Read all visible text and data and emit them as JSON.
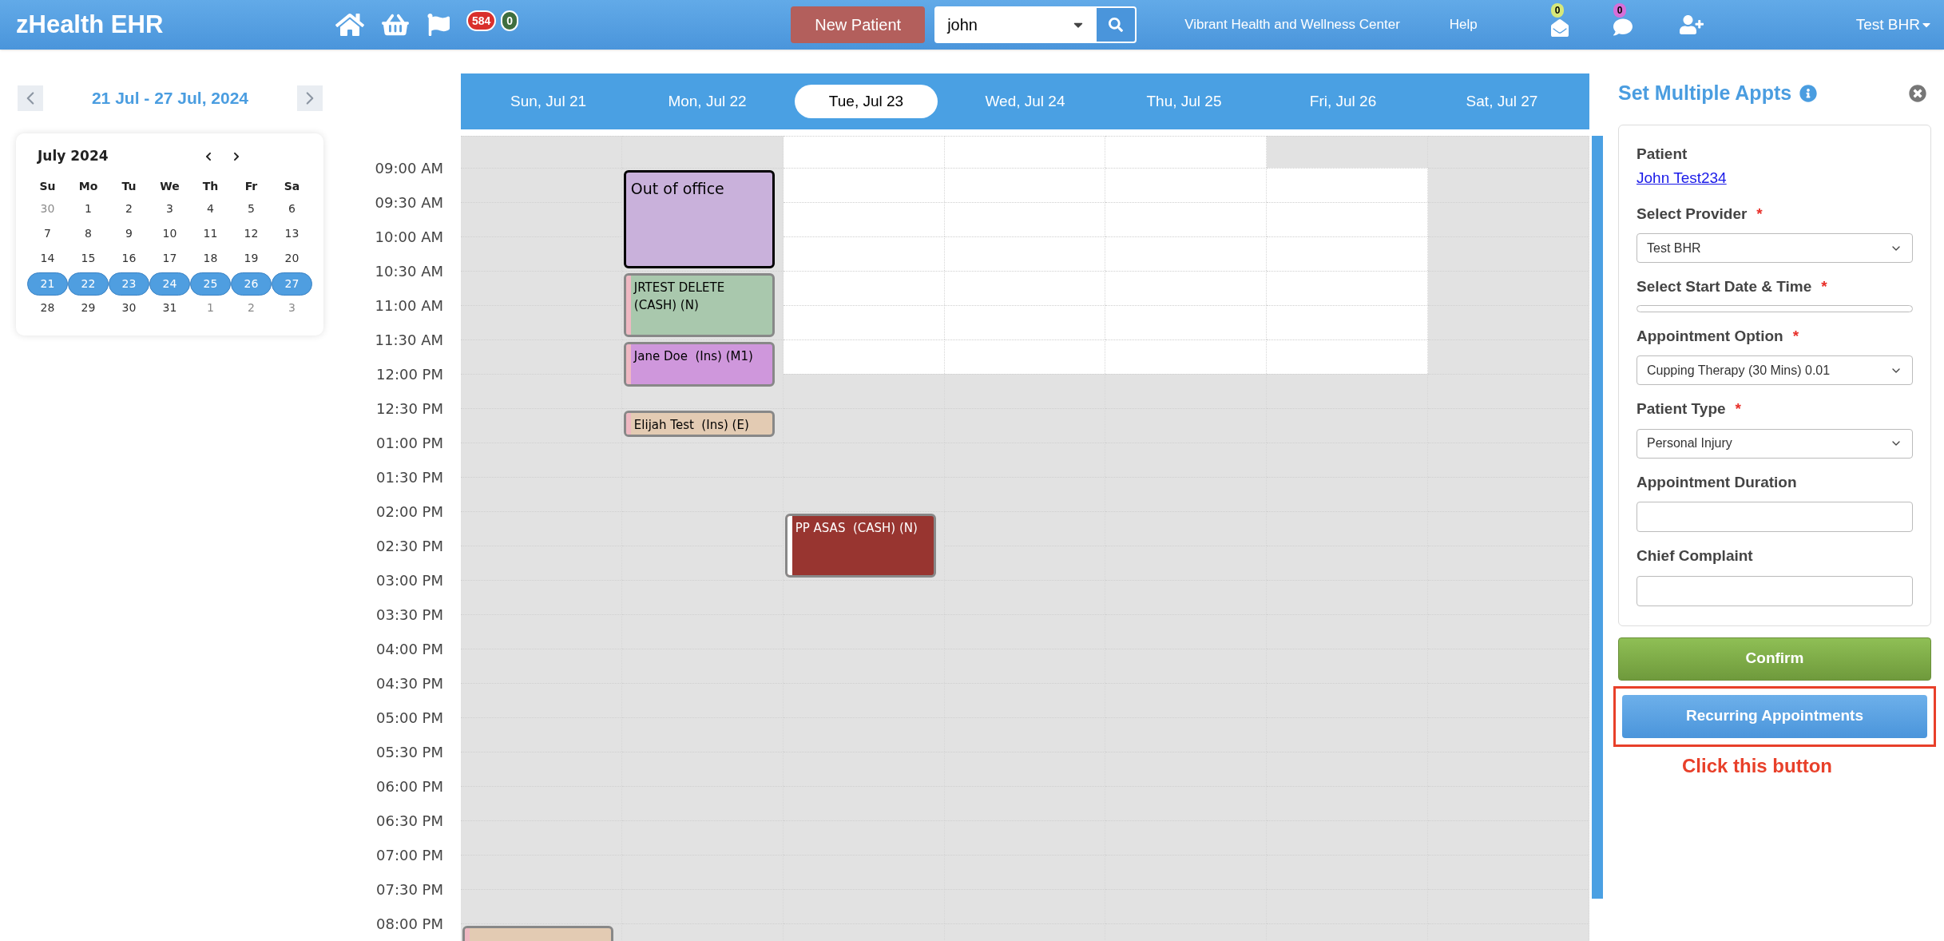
{
  "topbar": {
    "brand": "zHealth EHR",
    "badges": [
      {
        "count": "584",
        "color": "#d9302c"
      },
      {
        "count": "0",
        "color": "#3f6e3f"
      }
    ],
    "new_patient": "New Patient",
    "search": {
      "value": "john"
    },
    "clinic": "Vibrant Health and Wellness Center",
    "help": "Help",
    "mail_badge": {
      "count": "0",
      "color": "#d6e87a"
    },
    "chat_badge": {
      "count": "0",
      "color": "#d66fd8"
    },
    "user": "Test BHR"
  },
  "week_nav": {
    "range": "21 Jul - 27 Jul, 2024"
  },
  "mini_calendar": {
    "title": "July 2024",
    "weekdays": [
      "Su",
      "Mo",
      "Tu",
      "We",
      "Th",
      "Fr",
      "Sa"
    ],
    "weeks": [
      [
        {
          "day": "30",
          "outside": true,
          "selected": false
        },
        {
          "day": "1",
          "outside": false,
          "selected": false
        },
        {
          "day": "2",
          "outside": false,
          "selected": false
        },
        {
          "day": "3",
          "outside": false,
          "selected": false
        },
        {
          "day": "4",
          "outside": false,
          "selected": false
        },
        {
          "day": "5",
          "outside": false,
          "selected": false
        },
        {
          "day": "6",
          "outside": false,
          "selected": false
        }
      ],
      [
        {
          "day": "7",
          "outside": false,
          "selected": false
        },
        {
          "day": "8",
          "outside": false,
          "selected": false
        },
        {
          "day": "9",
          "outside": false,
          "selected": false
        },
        {
          "day": "10",
          "outside": false,
          "selected": false
        },
        {
          "day": "11",
          "outside": false,
          "selected": false
        },
        {
          "day": "12",
          "outside": false,
          "selected": false
        },
        {
          "day": "13",
          "outside": false,
          "selected": false
        }
      ],
      [
        {
          "day": "14",
          "outside": false,
          "selected": false
        },
        {
          "day": "15",
          "outside": false,
          "selected": false
        },
        {
          "day": "16",
          "outside": false,
          "selected": false
        },
        {
          "day": "17",
          "outside": false,
          "selected": false
        },
        {
          "day": "18",
          "outside": false,
          "selected": false
        },
        {
          "day": "19",
          "outside": false,
          "selected": false
        },
        {
          "day": "20",
          "outside": false,
          "selected": false
        }
      ],
      [
        {
          "day": "21",
          "outside": false,
          "selected": true
        },
        {
          "day": "22",
          "outside": false,
          "selected": true
        },
        {
          "day": "23",
          "outside": false,
          "selected": true
        },
        {
          "day": "24",
          "outside": false,
          "selected": true
        },
        {
          "day": "25",
          "outside": false,
          "selected": true
        },
        {
          "day": "26",
          "outside": false,
          "selected": true
        },
        {
          "day": "27",
          "outside": false,
          "selected": true
        }
      ],
      [
        {
          "day": "28",
          "outside": false,
          "selected": false
        },
        {
          "day": "29",
          "outside": false,
          "selected": false
        },
        {
          "day": "30",
          "outside": false,
          "selected": false
        },
        {
          "day": "31",
          "outside": false,
          "selected": false
        },
        {
          "day": "1",
          "outside": true,
          "selected": false
        },
        {
          "day": "2",
          "outside": true,
          "selected": false
        },
        {
          "day": "3",
          "outside": true,
          "selected": false
        }
      ]
    ]
  },
  "week_header": [
    {
      "label": "Sun, Jul 21",
      "selected": false
    },
    {
      "label": "Mon, Jul 22",
      "selected": false
    },
    {
      "label": "Tue, Jul 23",
      "selected": true
    },
    {
      "label": "Wed, Jul 24",
      "selected": false
    },
    {
      "label": "Thu, Jul 25",
      "selected": false
    },
    {
      "label": "Fri, Jul 26",
      "selected": false
    },
    {
      "label": "Sat, Jul 27",
      "selected": false
    }
  ],
  "time_slots": [
    {
      "cells": [
        {
          "open": false
        },
        {
          "open": false
        },
        {
          "open": true
        },
        {
          "open": true
        },
        {
          "open": true
        },
        {
          "open": false
        },
        {
          "open": false
        }
      ]
    },
    {
      "label": "09:00 AM",
      "cells": [
        {
          "open": false
        },
        {
          "open": false,
          "event": {
            "kind": "out-of-office",
            "text": "Out of office",
            "short": false,
            "color": "#c9b1db"
          }
        },
        {
          "open": true
        },
        {
          "open": true
        },
        {
          "open": true
        },
        {
          "open": true
        },
        {
          "open": false
        }
      ]
    },
    {
      "label": "09:30 AM",
      "cells": [
        {
          "open": false
        },
        {
          "covered": true
        },
        {
          "open": true
        },
        {
          "open": true
        },
        {
          "open": true
        },
        {
          "open": true
        },
        {
          "open": false
        }
      ]
    },
    {
      "label": "10:00 AM",
      "cells": [
        {
          "open": false
        },
        {
          "covered": true
        },
        {
          "open": true
        },
        {
          "open": true
        },
        {
          "open": true
        },
        {
          "open": true
        },
        {
          "open": false
        }
      ]
    },
    {
      "label": "10:30 AM",
      "cells": [
        {
          "open": false
        },
        {
          "open": false,
          "event": {
            "kind": "appointment",
            "text": "JRTEST DELETE  (CASH) (N)",
            "short": false,
            "color": "#a9c8ad"
          }
        },
        {
          "open": true
        },
        {
          "open": true
        },
        {
          "open": true
        },
        {
          "open": true
        },
        {
          "open": false
        }
      ]
    },
    {
      "label": "11:00 AM",
      "cells": [
        {
          "open": false
        },
        {
          "covered": true
        },
        {
          "open": true
        },
        {
          "open": true
        },
        {
          "open": true
        },
        {
          "open": true
        },
        {
          "open": false
        }
      ]
    },
    {
      "label": "11:30 AM",
      "cells": [
        {
          "open": false
        },
        {
          "open": false,
          "event": {
            "kind": "appointment",
            "text": "Jane Doe  (Ins) (M1)",
            "short": true,
            "color": "#cf97dc"
          }
        },
        {
          "open": true
        },
        {
          "open": true
        },
        {
          "open": true
        },
        {
          "open": true
        },
        {
          "open": false
        }
      ]
    },
    {
      "label": "12:00 PM",
      "cells": [
        {
          "open": false
        },
        {
          "covered": true
        },
        {
          "open": false
        },
        {
          "open": false
        },
        {
          "open": false
        },
        {
          "open": false
        },
        {
          "open": false
        }
      ]
    },
    {
      "label": "12:30 PM",
      "cells": [
        {
          "open": false
        },
        {
          "open": false,
          "event": {
            "kind": "appointment",
            "text": "Elijah Test  (Ins) (E)",
            "short": false,
            "color": "#e3cbb3"
          }
        },
        {
          "open": false
        },
        {
          "open": false
        },
        {
          "open": false
        },
        {
          "open": false
        },
        {
          "open": false
        }
      ]
    },
    {
      "label": "01:00 PM",
      "cells": [
        {
          "open": false
        },
        {
          "open": false
        },
        {
          "open": false
        },
        {
          "open": false
        },
        {
          "open": false
        },
        {
          "open": false
        },
        {
          "open": false
        }
      ]
    },
    {
      "label": "01:30 PM",
      "cells": [
        {
          "open": false
        },
        {
          "open": false
        },
        {
          "open": false
        },
        {
          "open": false
        },
        {
          "open": false
        },
        {
          "open": false
        },
        {
          "open": false
        }
      ]
    },
    {
      "label": "02:00 PM",
      "cells": [
        {
          "open": false
        },
        {
          "open": false
        },
        {
          "open": false,
          "event": {
            "kind": "appointment",
            "text": "PP ASAS  (CASH) (N)",
            "short": false,
            "color": "#983530"
          }
        },
        {
          "open": false
        },
        {
          "open": false
        },
        {
          "open": false
        },
        {
          "open": false
        }
      ]
    },
    {
      "label": "02:30 PM",
      "cells": [
        {
          "open": false
        },
        {
          "open": false
        },
        {
          "covered": true
        },
        {
          "open": false
        },
        {
          "open": false
        },
        {
          "open": false
        },
        {
          "open": false
        }
      ]
    },
    {
      "label": "03:00 PM",
      "cells": [
        {
          "open": false
        },
        {
          "open": false
        },
        {
          "open": false
        },
        {
          "open": false
        },
        {
          "open": false
        },
        {
          "open": false
        },
        {
          "open": false
        }
      ]
    },
    {
      "label": "03:30 PM",
      "cells": [
        {
          "open": false
        },
        {
          "open": false
        },
        {
          "open": false
        },
        {
          "open": false
        },
        {
          "open": false
        },
        {
          "open": false
        },
        {
          "open": false
        }
      ]
    },
    {
      "label": "04:00 PM",
      "cells": [
        {
          "open": false
        },
        {
          "open": false
        },
        {
          "open": false
        },
        {
          "open": false
        },
        {
          "open": false
        },
        {
          "open": false
        },
        {
          "open": false
        }
      ]
    },
    {
      "label": "04:30 PM",
      "cells": [
        {
          "open": false
        },
        {
          "open": false
        },
        {
          "open": false
        },
        {
          "open": false
        },
        {
          "open": false
        },
        {
          "open": false
        },
        {
          "open": false
        }
      ]
    },
    {
      "label": "05:00 PM",
      "cells": [
        {
          "open": false
        },
        {
          "open": false
        },
        {
          "open": false
        },
        {
          "open": false
        },
        {
          "open": false
        },
        {
          "open": false
        },
        {
          "open": false
        }
      ]
    },
    {
      "label": "05:30 PM",
      "cells": [
        {
          "open": false
        },
        {
          "open": false
        },
        {
          "open": false
        },
        {
          "open": false
        },
        {
          "open": false
        },
        {
          "open": false
        },
        {
          "open": false
        }
      ]
    },
    {
      "label": "06:00 PM",
      "cells": [
        {
          "open": false
        },
        {
          "open": false
        },
        {
          "open": false
        },
        {
          "open": false
        },
        {
          "open": false
        },
        {
          "open": false
        },
        {
          "open": false
        }
      ]
    },
    {
      "label": "06:30 PM",
      "cells": [
        {
          "open": false
        },
        {
          "open": false
        },
        {
          "open": false
        },
        {
          "open": false
        },
        {
          "open": false
        },
        {
          "open": false
        },
        {
          "open": false
        }
      ]
    },
    {
      "label": "07:00 PM",
      "cells": [
        {
          "open": false
        },
        {
          "open": false
        },
        {
          "open": false
        },
        {
          "open": false
        },
        {
          "open": false
        },
        {
          "open": false
        },
        {
          "open": false
        }
      ]
    },
    {
      "label": "07:30 PM",
      "cells": [
        {
          "open": false
        },
        {
          "open": false
        },
        {
          "open": false
        },
        {
          "open": false
        },
        {
          "open": false
        },
        {
          "open": false
        },
        {
          "open": false
        }
      ]
    },
    {
      "label": "08:00 PM",
      "cells": [
        {
          "open": false,
          "event": {
            "kind": "appointment",
            "short": false,
            "color": "#e3cbb3"
          }
        },
        {
          "open": false
        },
        {
          "open": false
        },
        {
          "open": false
        },
        {
          "open": false
        },
        {
          "open": false
        },
        {
          "open": false
        }
      ]
    }
  ],
  "panel": {
    "title": "Set Multiple Appts",
    "fields": [
      {
        "label": "Patient",
        "kind": "link",
        "value": "John Test234"
      },
      {
        "label": "Select Provider",
        "kind": "select",
        "value": "Test BHR",
        "required_mark": "*"
      },
      {
        "label": "Select Start Date & Time",
        "kind": "slim",
        "required_mark": "*"
      },
      {
        "label": "Appointment Option",
        "kind": "select",
        "value": "Cupping Therapy (30 Mins) 0.01",
        "required_mark": "*"
      },
      {
        "label": "Patient Type",
        "kind": "select",
        "value": "Personal Injury",
        "required_mark": "*"
      },
      {
        "label": "Appointment Duration",
        "kind": "input"
      },
      {
        "label": "Chief Complaint",
        "kind": "input"
      }
    ],
    "confirm": "Confirm",
    "recurring": {
      "label": "Recurring Appointments",
      "highlighted": true
    },
    "callout": "Click this button"
  }
}
